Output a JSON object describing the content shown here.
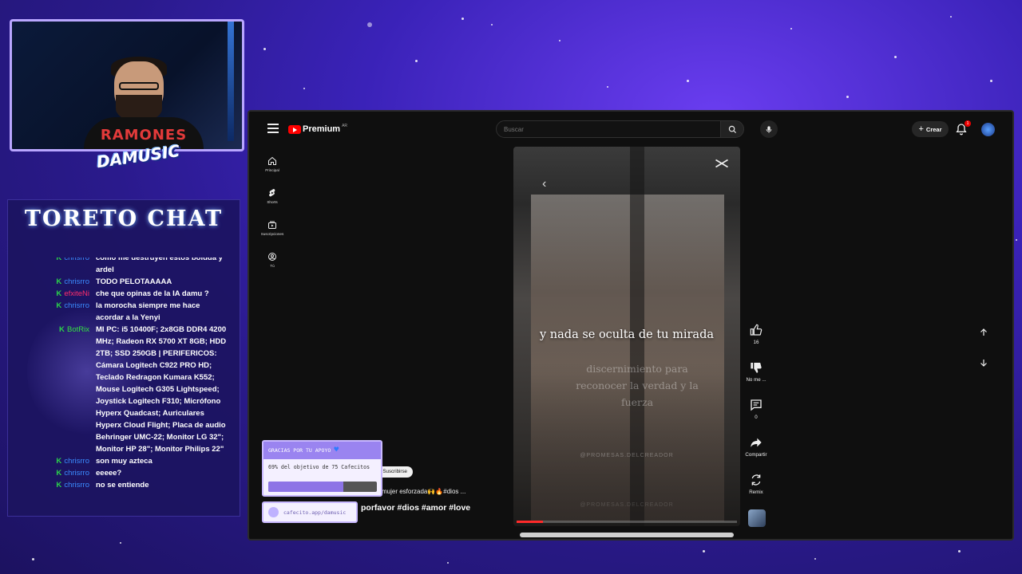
{
  "chat": {
    "title": "TORETO CHAT",
    "messages": [
      {
        "user": "chrisrro",
        "user_color": "#3b8cff",
        "text": "como me destruyen estos boluda y ardel"
      },
      {
        "user": "chrisrro",
        "user_color": "#3b8cff",
        "text": "TODO PELOTAAAAA"
      },
      {
        "user": "efxiteNi",
        "user_color": "#ff2d6a",
        "text": "che que opinas de la IA damu ?"
      },
      {
        "user": "chrisrro",
        "user_color": "#3b8cff",
        "text": "la morocha siempre me hace acordar a la Yenyi"
      },
      {
        "user": "BotRix",
        "user_color": "#34e043",
        "text": "MI PC: i5 10400F; 2x8GB DDR4 4200 MHz; Radeon RX 5700 XT 8GB; HDD 2TB; SSD 250GB | PERIFERICOS: Cámara Logitech C922 PRO HD; Teclado Redragon Kumara K552; Mouse Logitech G305 Lightspeed; Joystick Logitech F310; Micrófono Hyperx Quadcast; Auriculares Hyperx Cloud Flight; Placa de audio Behringer UMC-22; Monitor LG 32\"; Monitor HP 28\"; Monitor Philips 22\""
      },
      {
        "user": "chrisrro",
        "user_color": "#3b8cff",
        "text": "son muy azteca"
      },
      {
        "user": "chrisrro",
        "user_color": "#3b8cff",
        "text": "eeeee?"
      },
      {
        "user": "chrisrro",
        "user_color": "#3b8cff",
        "text": "no se entiende"
      }
    ],
    "badge": "K"
  },
  "webcam": {
    "shirt_text": "RAMONES",
    "channel_logo": "DAMUSIC"
  },
  "youtube": {
    "logo_text": "Premium",
    "country_code": "AR",
    "search_placeholder": "Buscar",
    "create_label": "Crear",
    "notification_count": "1",
    "nav": [
      {
        "label": "Principal",
        "icon": "home-icon"
      },
      {
        "label": "Shorts",
        "icon": "shorts-icon"
      },
      {
        "label": "Suscripciones",
        "icon": "subscriptions-icon"
      },
      {
        "label": "Tú",
        "icon": "you-icon"
      }
    ],
    "short": {
      "caption": "y nada se oculta de tu mirada",
      "faded_caption": "discernimiento para reconocer la verdad y la fuerza",
      "watermark": "@PROMESAS.DELCREADOR",
      "watermark_repeat": "@PROMESAS.DELCREADOR",
      "progress": 0.12
    },
    "actions": {
      "like_count": "16",
      "dislike_label": "No me ...",
      "comments_count": "0",
      "share_label": "Compartir",
      "remix_label": "Remix"
    },
    "subscribe_label": "Suscribirse",
    "description": "mujer esforzada🙌🔥#dios ...",
    "title": "porfavor #dios #amor #love"
  },
  "cafecito": {
    "header": "GRACIAS POR TU APOYO",
    "goal_text": "69% del objetivo de 75 Cafecitos",
    "progress": 0.69,
    "link": "cafecito.app/damusic"
  },
  "colors": {
    "accent": "#8d74e6",
    "youtube_red": "#ff0000",
    "chat_badge": "#2bd24a"
  }
}
